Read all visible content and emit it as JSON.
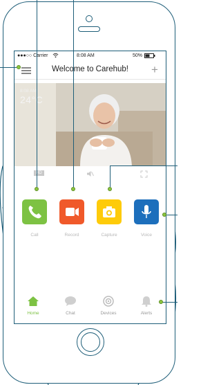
{
  "status_bar": {
    "carrier": "●●●○○ Carrier",
    "wifi_icon": "wifi-icon",
    "time": "8:08 AM",
    "battery": "50%",
    "battery_icon": "battery-icon"
  },
  "nav": {
    "title": "Welcome to Carehub!",
    "menu_icon": "menu-icon",
    "add_icon": "plus-icon"
  },
  "video": {
    "overlay_time": "8:08 AM",
    "overlay_temp": "24°C",
    "hd_label": "HD",
    "mute_icon": "speaker-mute-icon",
    "fullscreen_icon": "fullscreen-icon"
  },
  "actions": [
    {
      "label": "Call",
      "icon": "phone-icon",
      "color": "#7dc243"
    },
    {
      "label": "Record",
      "icon": "video-camera-icon",
      "color": "#f0592a"
    },
    {
      "label": "Capture",
      "icon": "camera-icon",
      "color": "#fecb0a"
    },
    {
      "label": "Voice",
      "icon": "microphone-icon",
      "color": "#1d6fbc"
    }
  ],
  "tabs": [
    {
      "label": "Home",
      "icon": "home-icon",
      "active": true
    },
    {
      "label": "Chat",
      "icon": "chat-bubble-icon",
      "active": false
    },
    {
      "label": "Devices",
      "icon": "devices-icon",
      "active": false
    },
    {
      "label": "Alerts",
      "icon": "bell-icon",
      "active": false
    }
  ],
  "colors": {
    "accent_green": "#7dc243",
    "outline_blue": "#1d5d78",
    "callout_dot": "#8cc63f"
  }
}
